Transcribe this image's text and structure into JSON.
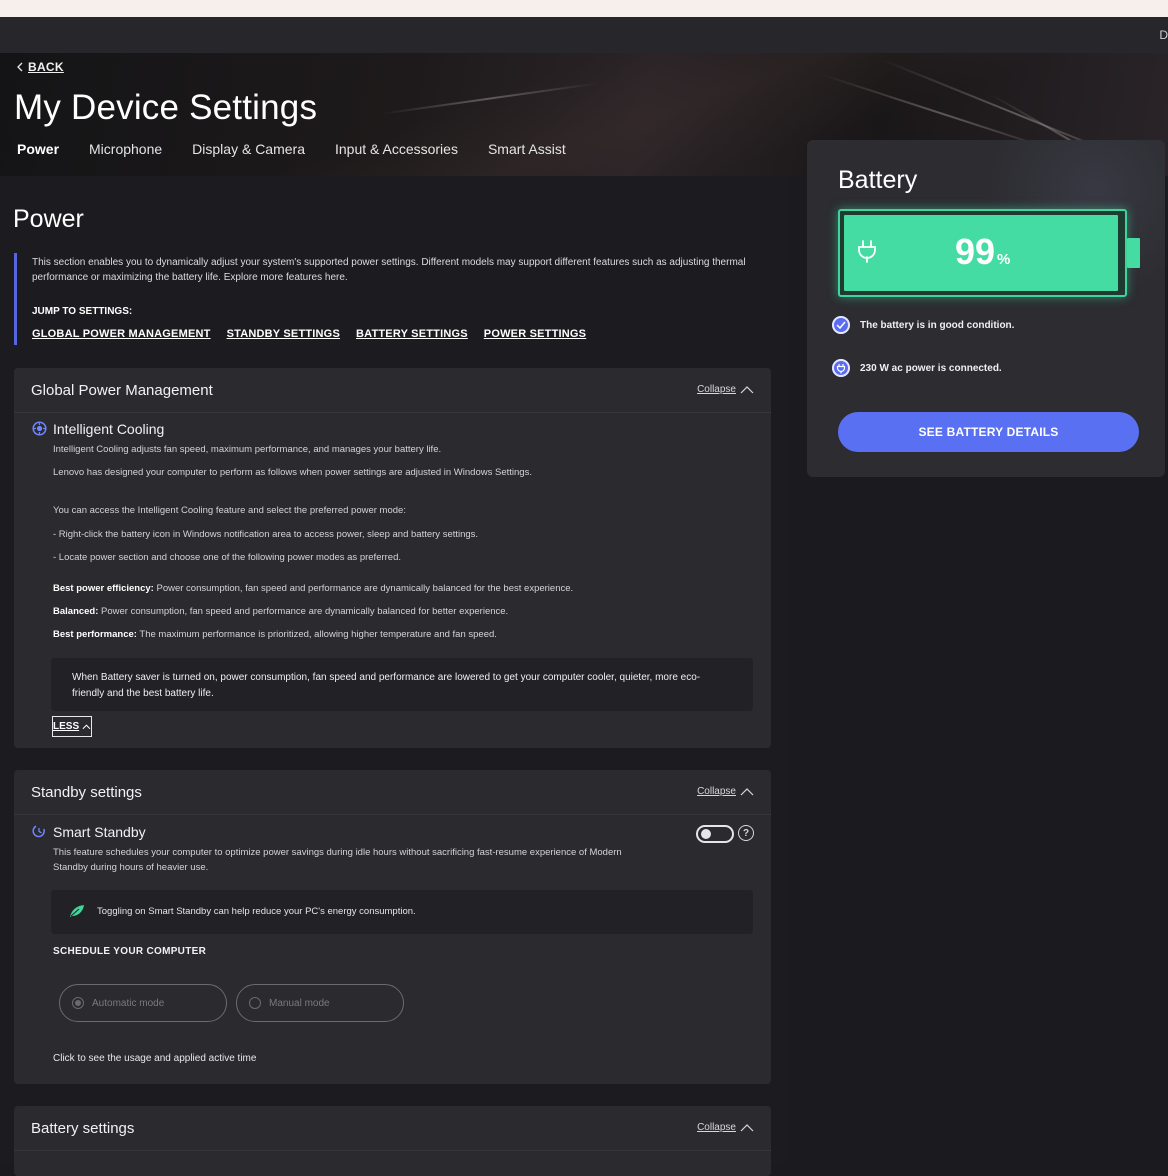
{
  "window": {
    "user_initial": "D"
  },
  "nav": {
    "back_label": "BACK"
  },
  "page": {
    "title": "My Device Settings",
    "tabs": [
      {
        "label": "Power",
        "active": true
      },
      {
        "label": "Microphone",
        "active": false
      },
      {
        "label": "Display & Camera",
        "active": false
      },
      {
        "label": "Input & Accessories",
        "active": false
      },
      {
        "label": "Smart Assist",
        "active": false
      }
    ]
  },
  "section": {
    "title": "Power",
    "description": "This section enables you to dynamically adjust your system's supported power settings. Different models may support different features such as adjusting thermal performance or maximizing the battery life. Explore more features here.",
    "jump_label": "JUMP TO SETTINGS:",
    "jump_links": [
      "GLOBAL POWER MANAGEMENT",
      "STANDBY SETTINGS",
      "BATTERY SETTINGS",
      "POWER SETTINGS"
    ]
  },
  "global_power": {
    "title": "Global Power Management",
    "collapse_label": "Collapse",
    "feature_title": "Intelligent Cooling",
    "lines": [
      "Intelligent Cooling adjusts fan speed, maximum performance, and manages your battery life.",
      "Lenovo has designed your computer to perform as follows when power settings are adjusted in Windows Settings.",
      "You can access the Intelligent Cooling feature and select the preferred power mode:",
      "- Right-click the battery icon in Windows notification area to access power, sleep and battery settings.",
      "- Locate power section and choose one of the following power modes as preferred."
    ],
    "modes": [
      {
        "name": "Best power efficiency:",
        "text": "Power consumption, fan speed and performance are dynamically balanced for the best experience."
      },
      {
        "name": "Balanced:",
        "text": "Power consumption, fan speed and performance are dynamically balanced for better experience."
      },
      {
        "name": "Best performance:",
        "text": "The maximum performance is prioritized, allowing higher temperature and fan speed."
      }
    ],
    "note": "When Battery saver is turned on, power consumption, fan speed and performance are lowered to get your computer cooler, quieter, more eco-friendly and the best battery life.",
    "less_label": "LESS"
  },
  "standby": {
    "title": "Standby settings",
    "collapse_label": "Collapse",
    "feature_title": "Smart Standby",
    "description": "This feature schedules your computer to optimize power savings during idle hours without sacrificing fast-resume experience of Modern Standby during hours of heavier use.",
    "toggle_on": false,
    "help_glyph": "?",
    "tip": "Toggling on Smart Standby can help reduce your PC's energy consumption.",
    "schedule_label": "SCHEDULE YOUR COMPUTER",
    "mode_automatic": "Automatic mode",
    "mode_manual": "Manual mode",
    "selected_mode": "Automatic mode",
    "usage_link": "Click to see the usage and applied active time"
  },
  "battery_settings": {
    "title": "Battery settings",
    "collapse_label": "Collapse"
  },
  "battery": {
    "title": "Battery",
    "percent": "99",
    "percent_unit": "%",
    "level": 0.99,
    "status_condition": "The battery is in good condition.",
    "status_power": "230 W ac power is connected.",
    "details_button": "SEE BATTERY DETAILS",
    "accent_color": "#45dca4",
    "button_color": "#5a70f2"
  }
}
